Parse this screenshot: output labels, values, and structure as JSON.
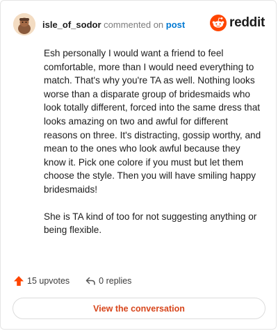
{
  "header": {
    "username": "isle_of_sodor",
    "verb": "commented on",
    "link_label": "post",
    "brand_name": "reddit",
    "brand_color": "#ff4500"
  },
  "comment": {
    "paragraphs": [
      "Esh personally I would want a friend to feel comfortable, more than I would need everything to match. That's why you're TA as well. Nothing looks worse than a disparate group of bridesmaids who look totally different, forced into the same dress that looks amazing on two and awful for different reasons on three. It's distracting, gossip worthy, and mean to the ones who look awful because they know it. Pick one colore if you must but let them choose the style. Then you will have smiling happy bridesmaids!",
      "She is TA kind of too for not suggesting anything or being flexible."
    ]
  },
  "actions": {
    "upvotes": "15 upvotes",
    "replies": "0 replies",
    "upvote_icon": "upvote-arrow-icon",
    "reply_icon": "reply-arrow-icon",
    "upvote_color": "#ff4500"
  },
  "cta": {
    "label": "View the conversation",
    "color": "#d7451b"
  }
}
